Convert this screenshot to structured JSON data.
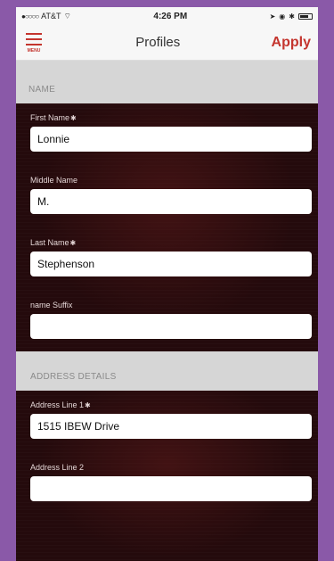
{
  "status_bar": {
    "carrier": "AT&T",
    "time": "4:26 PM"
  },
  "nav": {
    "menu_label": "MENU",
    "title": "Profiles",
    "apply_label": "Apply"
  },
  "sections": {
    "name_header": "NAME",
    "address_header": "ADDRESS DETAILS"
  },
  "fields": {
    "first_name": {
      "label": "First Name",
      "value": "Lonnie"
    },
    "middle_name": {
      "label": "Middle Name",
      "value": "M."
    },
    "last_name": {
      "label": "Last Name",
      "value": "Stephenson"
    },
    "name_suffix": {
      "label": "name Suffix",
      "value": ""
    },
    "address_line_1": {
      "label": "Address Line 1",
      "value": "1515 IBEW Drive"
    },
    "address_line_2": {
      "label": "Address Line 2",
      "value": ""
    }
  },
  "colors": {
    "accent": "#c4352e",
    "frame": "#8a59a8",
    "form_bg": "#240a0c",
    "section_header_bg": "#d6d6d6"
  }
}
